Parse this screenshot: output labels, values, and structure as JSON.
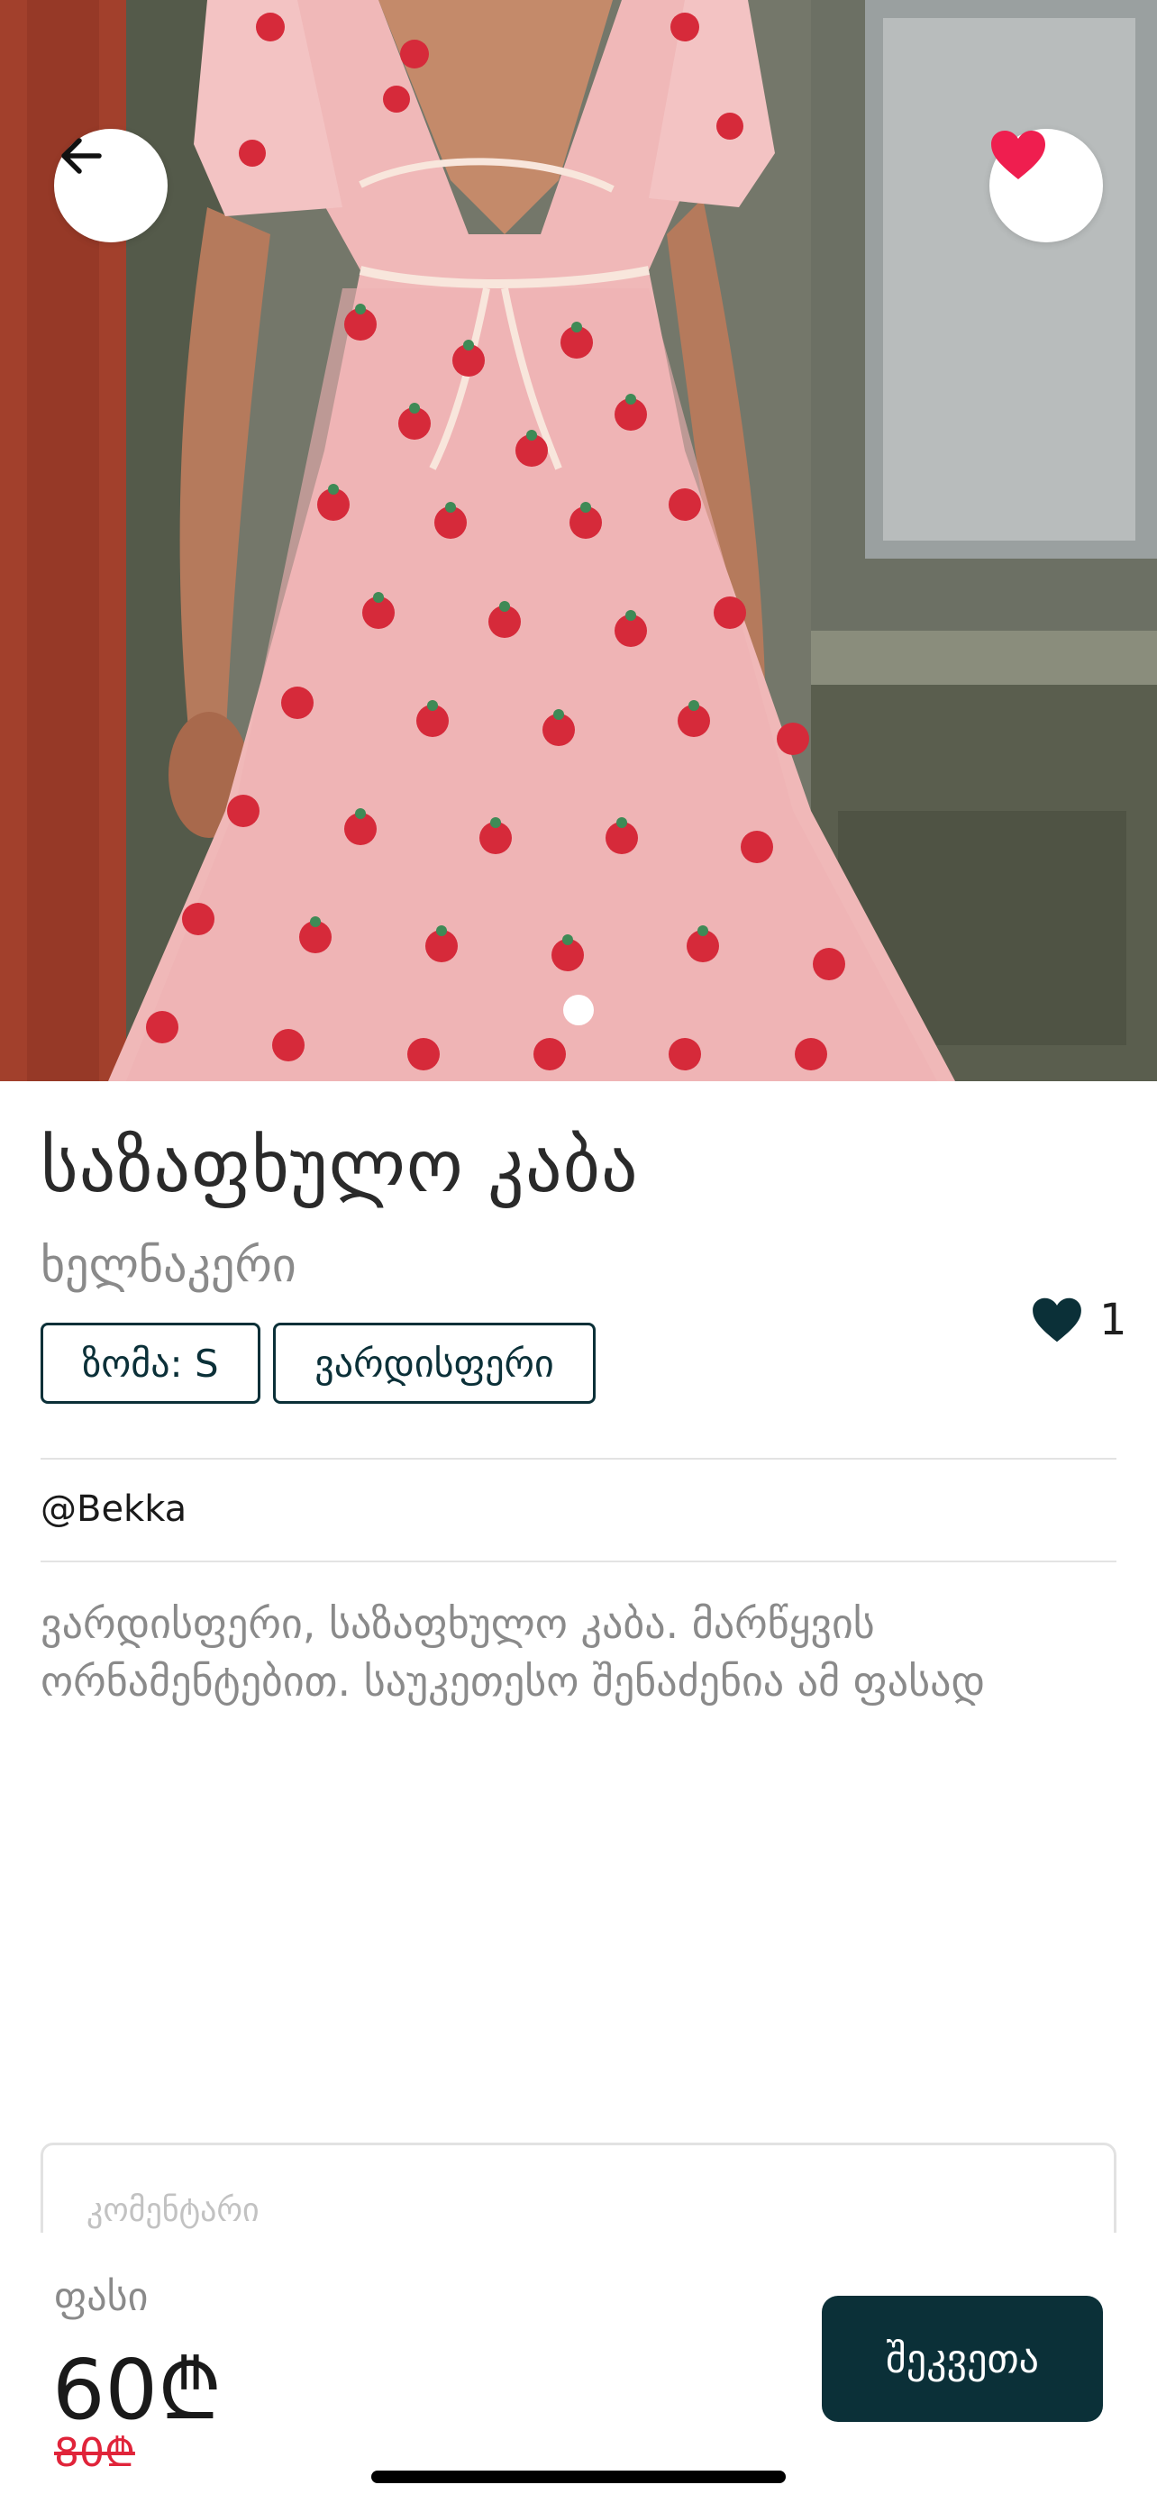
{
  "product": {
    "title": "საზაფხულო კაბა",
    "subtitle": "ხელნაკერი",
    "size_tag": "ზომა: S",
    "color_tag": "ვარდისფერი",
    "likes": "1",
    "seller": "@Bekka",
    "description": "ვარდისფერი, საზაფხულო კაბა. მარწყვის ორნამენტებით. საუკეთესო შენაძენია ამ ფასად"
  },
  "gallery": {
    "current_page": 1,
    "total_pages": 1
  },
  "comment": {
    "placeholder": "კომენტარი"
  },
  "purchase": {
    "price_label": "ფასი",
    "price": "60₾",
    "old_price": "80₾",
    "order_label": "შეკვეთა"
  },
  "icons": {
    "back": "arrow-left-icon",
    "favorite": "heart-filled-icon",
    "likes": "heart-icon"
  },
  "colors": {
    "accent": "#0b3038",
    "favorite": "#ef1e4f",
    "old_price": "#e0243a"
  }
}
